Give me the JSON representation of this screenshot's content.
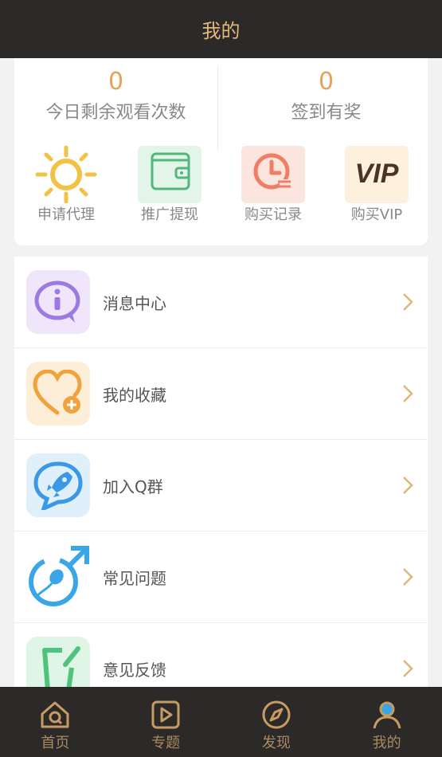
{
  "header": {
    "title": "我的"
  },
  "stats": [
    {
      "value": "0",
      "label": "今日剩余观看次数"
    },
    {
      "value": "0",
      "label": "签到有奖"
    }
  ],
  "quick_actions": [
    {
      "label": "申请代理",
      "icon": "sun-icon"
    },
    {
      "label": "推广提现",
      "icon": "wallet-icon"
    },
    {
      "label": "购买记录",
      "icon": "clock-list-icon"
    },
    {
      "label": "购买VIP",
      "icon": "vip-icon",
      "icon_text": "VIP"
    }
  ],
  "menu": [
    {
      "label": "消息中心",
      "icon": "info-message-icon"
    },
    {
      "label": "我的收藏",
      "icon": "heart-add-icon"
    },
    {
      "label": "加入Q群",
      "icon": "rocket-chat-icon"
    },
    {
      "label": "常见问题",
      "icon": "male-symbol-icon"
    },
    {
      "label": "意见反馈",
      "icon": "feedback-edit-icon"
    }
  ],
  "tabbar": [
    {
      "label": "首页",
      "icon": "home-icon"
    },
    {
      "label": "专题",
      "icon": "play-icon"
    },
    {
      "label": "发现",
      "icon": "compass-icon"
    },
    {
      "label": "我的",
      "icon": "user-icon",
      "active": true
    }
  ],
  "colors": {
    "header_bg": "#2b2a29",
    "accent": "#e5b77c",
    "stat_number": "#e4a35a",
    "chevron": "#e0b57a"
  }
}
